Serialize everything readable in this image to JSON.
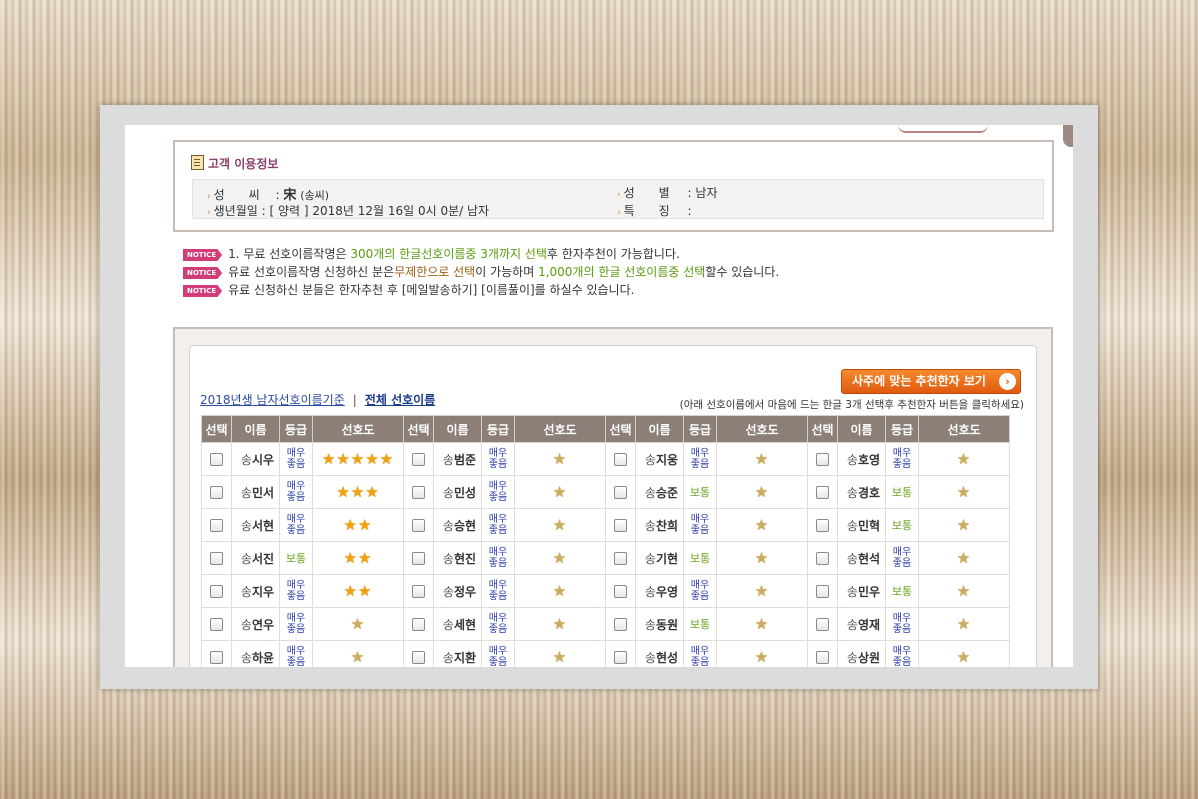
{
  "customer_info": {
    "title": "고객 이용정보",
    "surname_label": "성　　씨",
    "surname_hanja": "宋",
    "surname_value": "(송씨)",
    "birth_label": "생년월일",
    "birth_value": "[ 양력 ] 2018년 12월 16일 0시 0분/ 남자",
    "gender_label": "성　　별",
    "gender_value": "남자",
    "feature_label": "특　　징",
    "feature_value": ""
  },
  "notices": {
    "tag": "NOTICE",
    "n1_a": "1. 무료 선호이름작명은 ",
    "n1_b": "300개의 한글선호이름중 3개까지 선택",
    "n1_c": "후 한자추천이 가능합니다.",
    "n2_a": "유료 선호이름작명 신청하신 분은",
    "n2_b": "무제한으로 선택",
    "n2_c": "이 가능하며 ",
    "n2_d": "1,000개의 한글 선호이름중 선택",
    "n2_e": "할수 있습니다.",
    "n3": "유료 신청하신 분들은 한자추천 후 [메일발송하기] [이름풀이]를 하실수 있습니다."
  },
  "list": {
    "recommend_button": "사주에 맞는 추천한자 보기",
    "recommend_arrow": "›",
    "link_basis": "2018년생 남자선호이름기준",
    "link_separator": "|",
    "link_all": "전체 선호이름",
    "hint": "(아래 선호이름에서 마음에 드는 한글 3개 선택후 추천한자 버튼을 클릭하세요)",
    "headers": {
      "select": "선택",
      "name": "이름",
      "grade": "등급",
      "preference": "선호도"
    },
    "surname": "송",
    "grades": {
      "very_good": "매우좋음",
      "normal": "보통"
    },
    "rows": [
      [
        {
          "name": "시우",
          "grade": "매우좋음",
          "stars": 5
        },
        {
          "name": "범준",
          "grade": "매우좋음",
          "stars": 1
        },
        {
          "name": "지웅",
          "grade": "매우좋음",
          "stars": 1
        },
        {
          "name": "호영",
          "grade": "매우좋음",
          "stars": 1
        }
      ],
      [
        {
          "name": "민서",
          "grade": "매우좋음",
          "stars": 3
        },
        {
          "name": "민성",
          "grade": "매우좋음",
          "stars": 1
        },
        {
          "name": "승준",
          "grade": "보통",
          "stars": 1
        },
        {
          "name": "경호",
          "grade": "보통",
          "stars": 1
        }
      ],
      [
        {
          "name": "서현",
          "grade": "매우좋음",
          "stars": 2
        },
        {
          "name": "승현",
          "grade": "매우좋음",
          "stars": 1
        },
        {
          "name": "찬희",
          "grade": "매우좋음",
          "stars": 1
        },
        {
          "name": "민혁",
          "grade": "보통",
          "stars": 1
        }
      ],
      [
        {
          "name": "서진",
          "grade": "보통",
          "stars": 2
        },
        {
          "name": "현진",
          "grade": "매우좋음",
          "stars": 1
        },
        {
          "name": "기현",
          "grade": "보통",
          "stars": 1
        },
        {
          "name": "현석",
          "grade": "매우좋음",
          "stars": 1
        }
      ],
      [
        {
          "name": "지우",
          "grade": "매우좋음",
          "stars": 2
        },
        {
          "name": "정우",
          "grade": "매우좋음",
          "stars": 1
        },
        {
          "name": "우영",
          "grade": "매우좋음",
          "stars": 1
        },
        {
          "name": "민우",
          "grade": "보통",
          "stars": 1
        }
      ],
      [
        {
          "name": "연우",
          "grade": "매우좋음",
          "stars": 1
        },
        {
          "name": "세현",
          "grade": "매우좋음",
          "stars": 1
        },
        {
          "name": "동원",
          "grade": "보통",
          "stars": 1
        },
        {
          "name": "영재",
          "grade": "매우좋음",
          "stars": 1
        }
      ],
      [
        {
          "name": "하윤",
          "grade": "매우좋음",
          "stars": 1
        },
        {
          "name": "지환",
          "grade": "매우좋음",
          "stars": 1
        },
        {
          "name": "현성",
          "grade": "매우좋음",
          "stars": 1
        },
        {
          "name": "상원",
          "grade": "매우좋음",
          "stars": 1
        }
      ]
    ]
  },
  "colors": {
    "accent_orange": "#e05a10",
    "header_brown": "#8b7f77",
    "notice_pink": "#d23c78",
    "grade_blue": "#2a3aa8",
    "grade_green": "#6aa520",
    "star_gold": "#f2a20c"
  }
}
